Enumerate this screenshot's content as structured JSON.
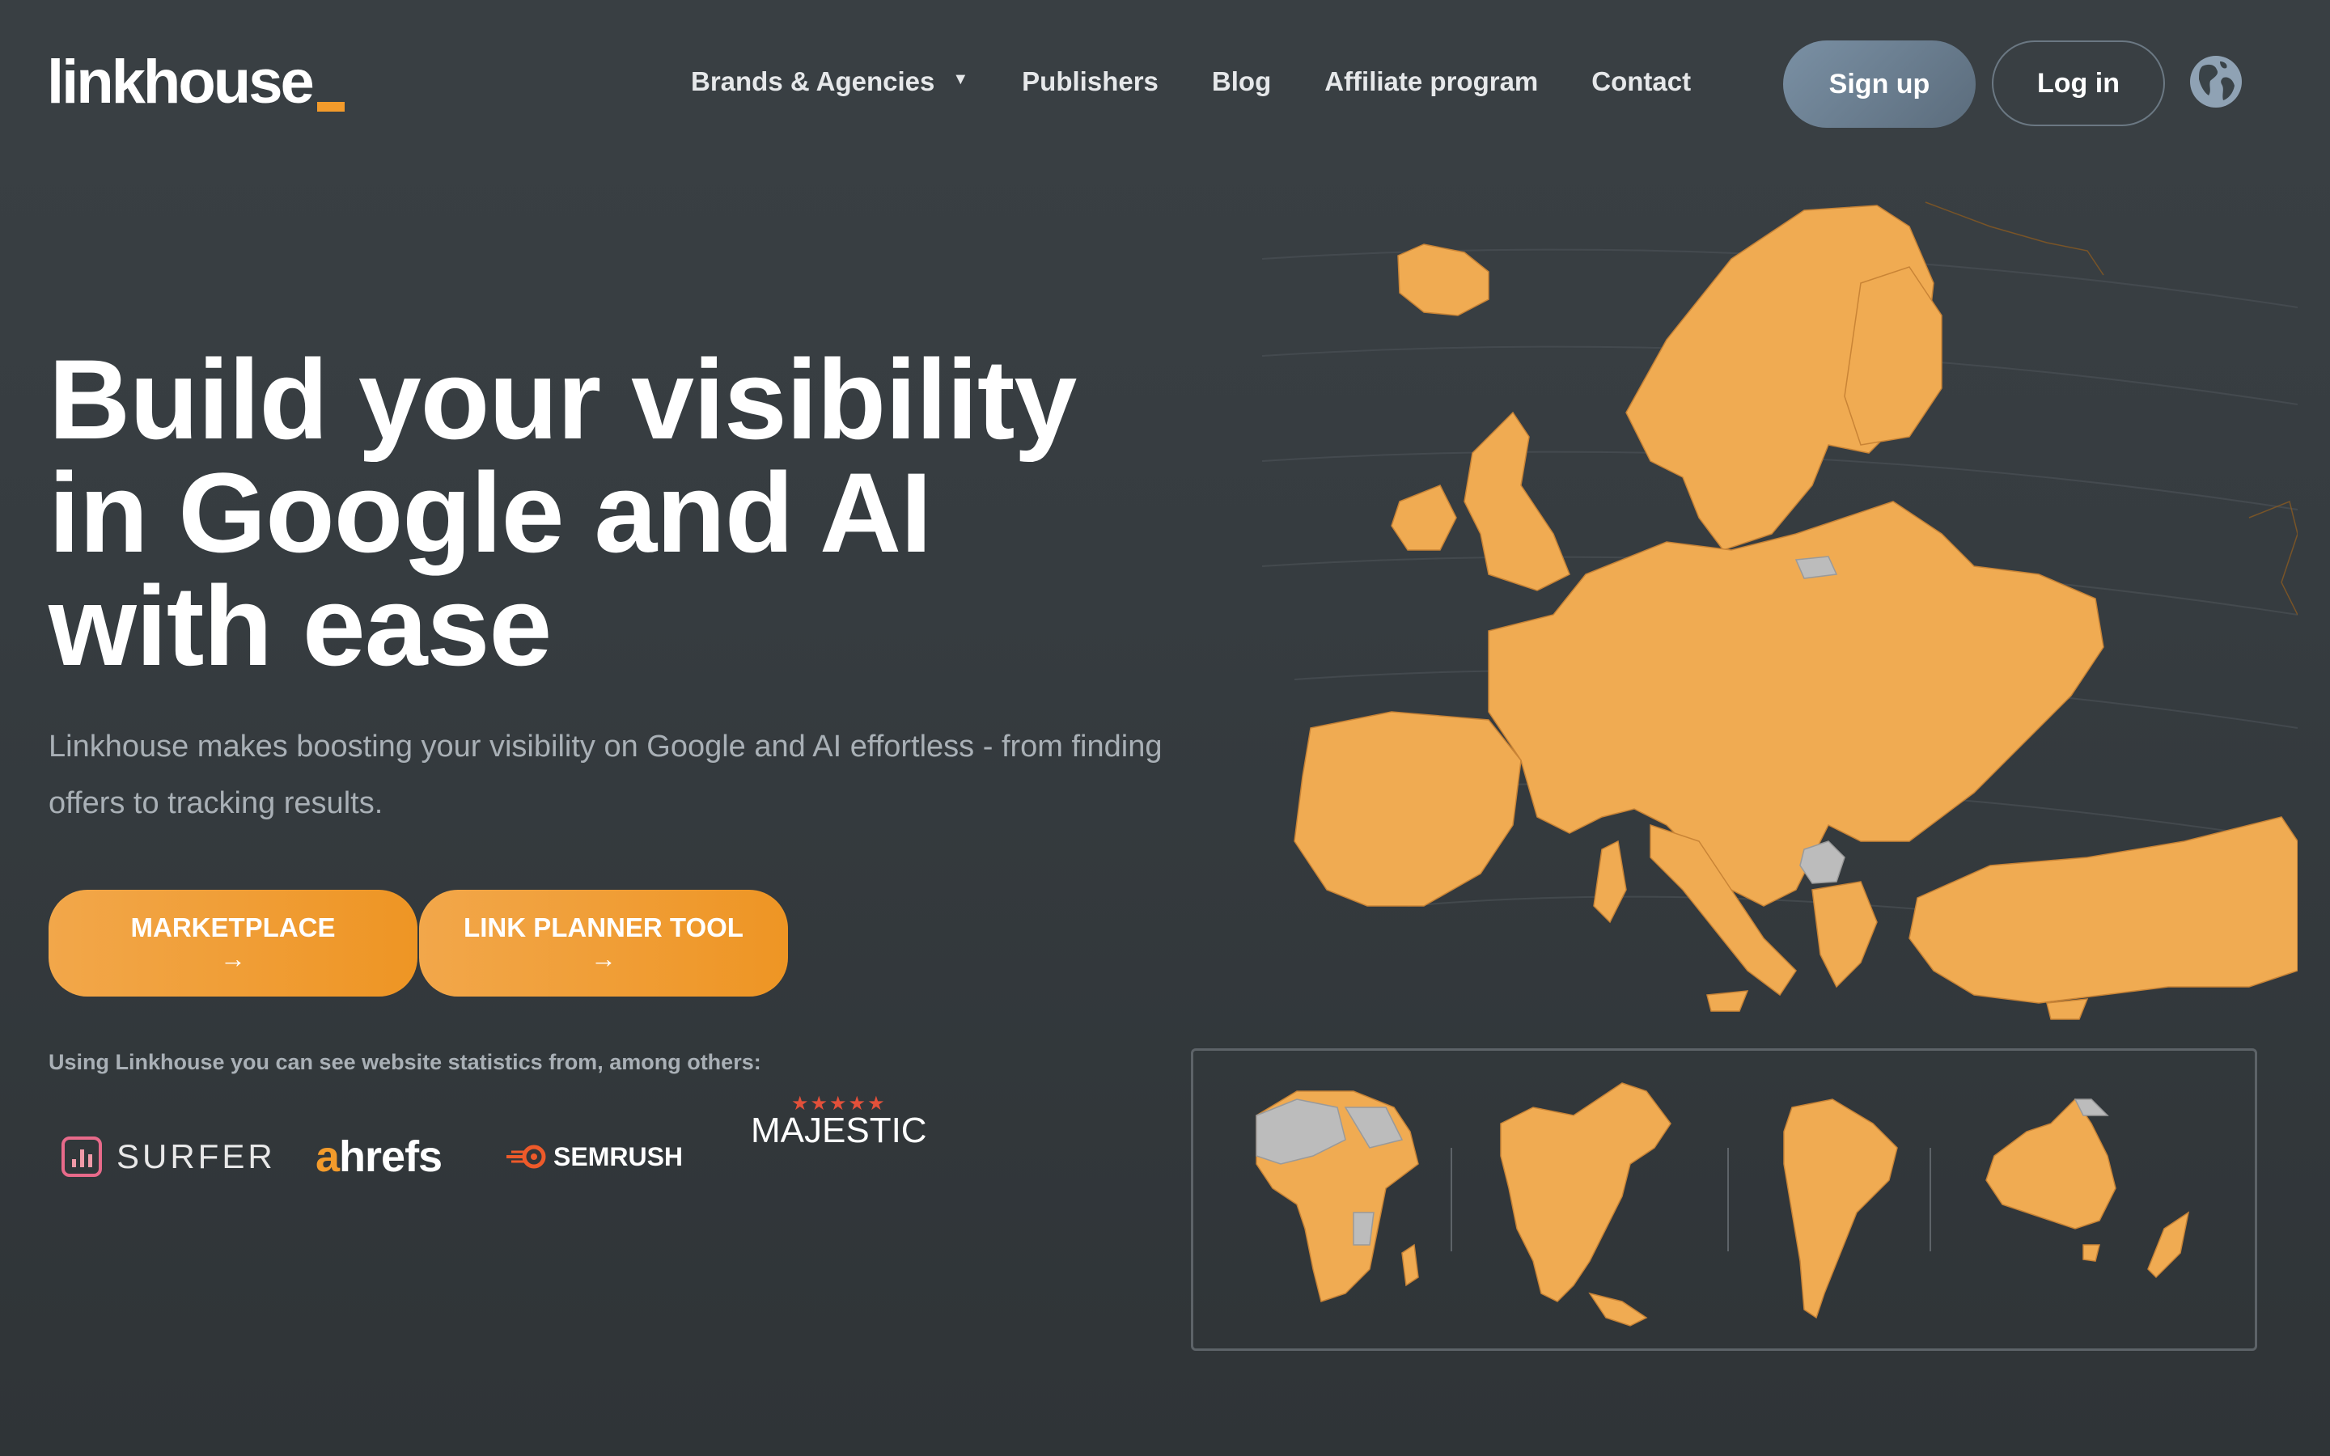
{
  "header": {
    "logo_text": "linkhouse",
    "nav": [
      {
        "label": "Brands & Agencies",
        "has_dropdown": true,
        "caret": "▼"
      },
      {
        "label": "Publishers"
      },
      {
        "label": "Blog"
      },
      {
        "label": "Affiliate program"
      },
      {
        "label": "Contact"
      }
    ],
    "signup_label": "Sign up",
    "login_label": "Log in",
    "language_icon": "globe-icon"
  },
  "hero": {
    "headline_lines": [
      "Build your visibility",
      "in Google and AI",
      "with ease"
    ],
    "subtitle": "Linkhouse makes boosting your visibility on Google and AI effortless - from finding offers to tracking results.",
    "cta": [
      {
        "label": "MARKETPLACE",
        "arrow": "→"
      },
      {
        "label": "LINK PLANNER TOOL",
        "arrow": "→"
      }
    ],
    "stats_text": "Using Linkhouse you can see website statistics from, among others:",
    "partners": [
      {
        "name": "SURFER",
        "icon": "surfer-logo-icon"
      },
      {
        "name": "ahrefs",
        "icon": "ahrefs-logo"
      },
      {
        "name": "SEMRUSH",
        "icon": "semrush-logo-icon"
      },
      {
        "name": "MAJESTIC",
        "icon": "majestic-logo-stars"
      }
    ]
  },
  "colors": {
    "accent_orange": "#f2a74a",
    "map_fill": "#f0ab52",
    "map_inactive": "#bcbcbc",
    "background": "#363c40",
    "signup_bg": "#6f8498"
  },
  "maps": {
    "main": "europe-map",
    "panel": [
      "africa-map",
      "north-america-map",
      "south-america-map",
      "oceania-map"
    ]
  }
}
